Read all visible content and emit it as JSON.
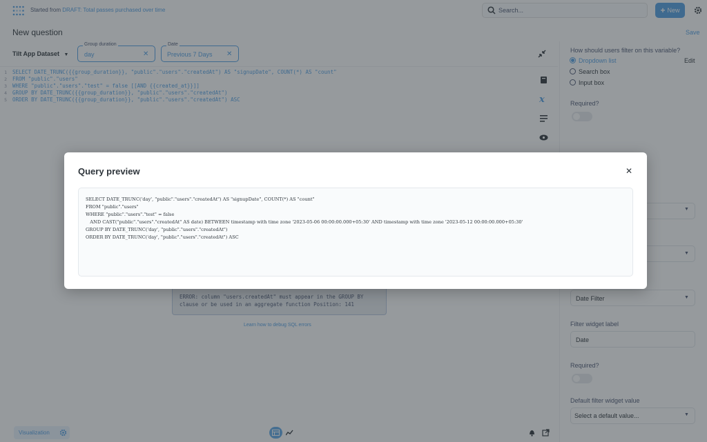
{
  "topbar": {
    "crumb_prefix": "Started from",
    "crumb_link": "DRAFT: Total passes purchased over time",
    "search_placeholder": "Search...",
    "new_label": "New"
  },
  "header": {
    "title": "New question",
    "save_label": "Save"
  },
  "filters": {
    "dataset": "Tilt App Dataset",
    "group": {
      "label": "Group duration",
      "value": "day"
    },
    "date": {
      "label": "Date",
      "value": "Previous 7 Days"
    }
  },
  "editor": {
    "line_numbers": [
      "1",
      "2",
      "3",
      "4",
      "5"
    ],
    "lines": [
      "SELECT DATE_TRUNC({{group_duration}}, \"public\".\"users\".\"createdAt\") AS \"signupDate\", COUNT(*) AS \"count\"",
      "FROM \"public\".\"users\"",
      "WHERE \"public\".\"users\".\"test\" = false [[AND {{created_at}}]]",
      "GROUP BY DATE_TRUNC({{group_duration}}, \"public\".\"users\".\"createdAt\")",
      "ORDER BY DATE_TRUNC({{group_duration}}, \"public\".\"users\".\"createdAt\") ASC"
    ]
  },
  "error": {
    "line1": "ERROR: column \"users.createdAt\" must appear in the GROUP BY",
    "line2": "clause or be used in an aggregate function Position: 141",
    "link": "Learn how to debug SQL errors"
  },
  "panel": {
    "filter_question": "How should users filter on this variable?",
    "options": [
      "Dropdown list",
      "Search box",
      "Input box"
    ],
    "selected_option": "Dropdown list",
    "edit_label": "Edit",
    "required_label_1": "Required?",
    "filter_type_value": "Date Filter",
    "widget_label_title": "Filter widget label",
    "widget_label_value": "Date",
    "required_label_2": "Required?",
    "default_title": "Default filter widget value",
    "default_placeholder": "Select a default value..."
  },
  "bottom": {
    "viz_label": "Visualization"
  },
  "modal": {
    "title": "Query preview",
    "lines": [
      "SELECT DATE_TRUNC('day', \"public\".\"users\".\"createdAt\") AS \"signupDate\", COUNT(*) AS \"count\"",
      "FROM \"public\".\"users\"",
      "WHERE \"public\".\"users\".\"test\" = false",
      "   AND CAST(\"public\".\"users\".\"createdAt\" AS date) BETWEEN timestamp with time zone '2023-05-06 00:00:00.000+05:30' AND timestamp with time zone '2023-05-12 00:00:00.000+05:30'",
      "GROUP BY DATE_TRUNC('day', \"public\".\"users\".\"createdAt\")",
      "ORDER BY DATE_TRUNC('day', \"public\".\"users\".\"createdAt\") ASC"
    ]
  },
  "colors": {
    "brand": "#509ee3",
    "text": "#4c5773"
  }
}
